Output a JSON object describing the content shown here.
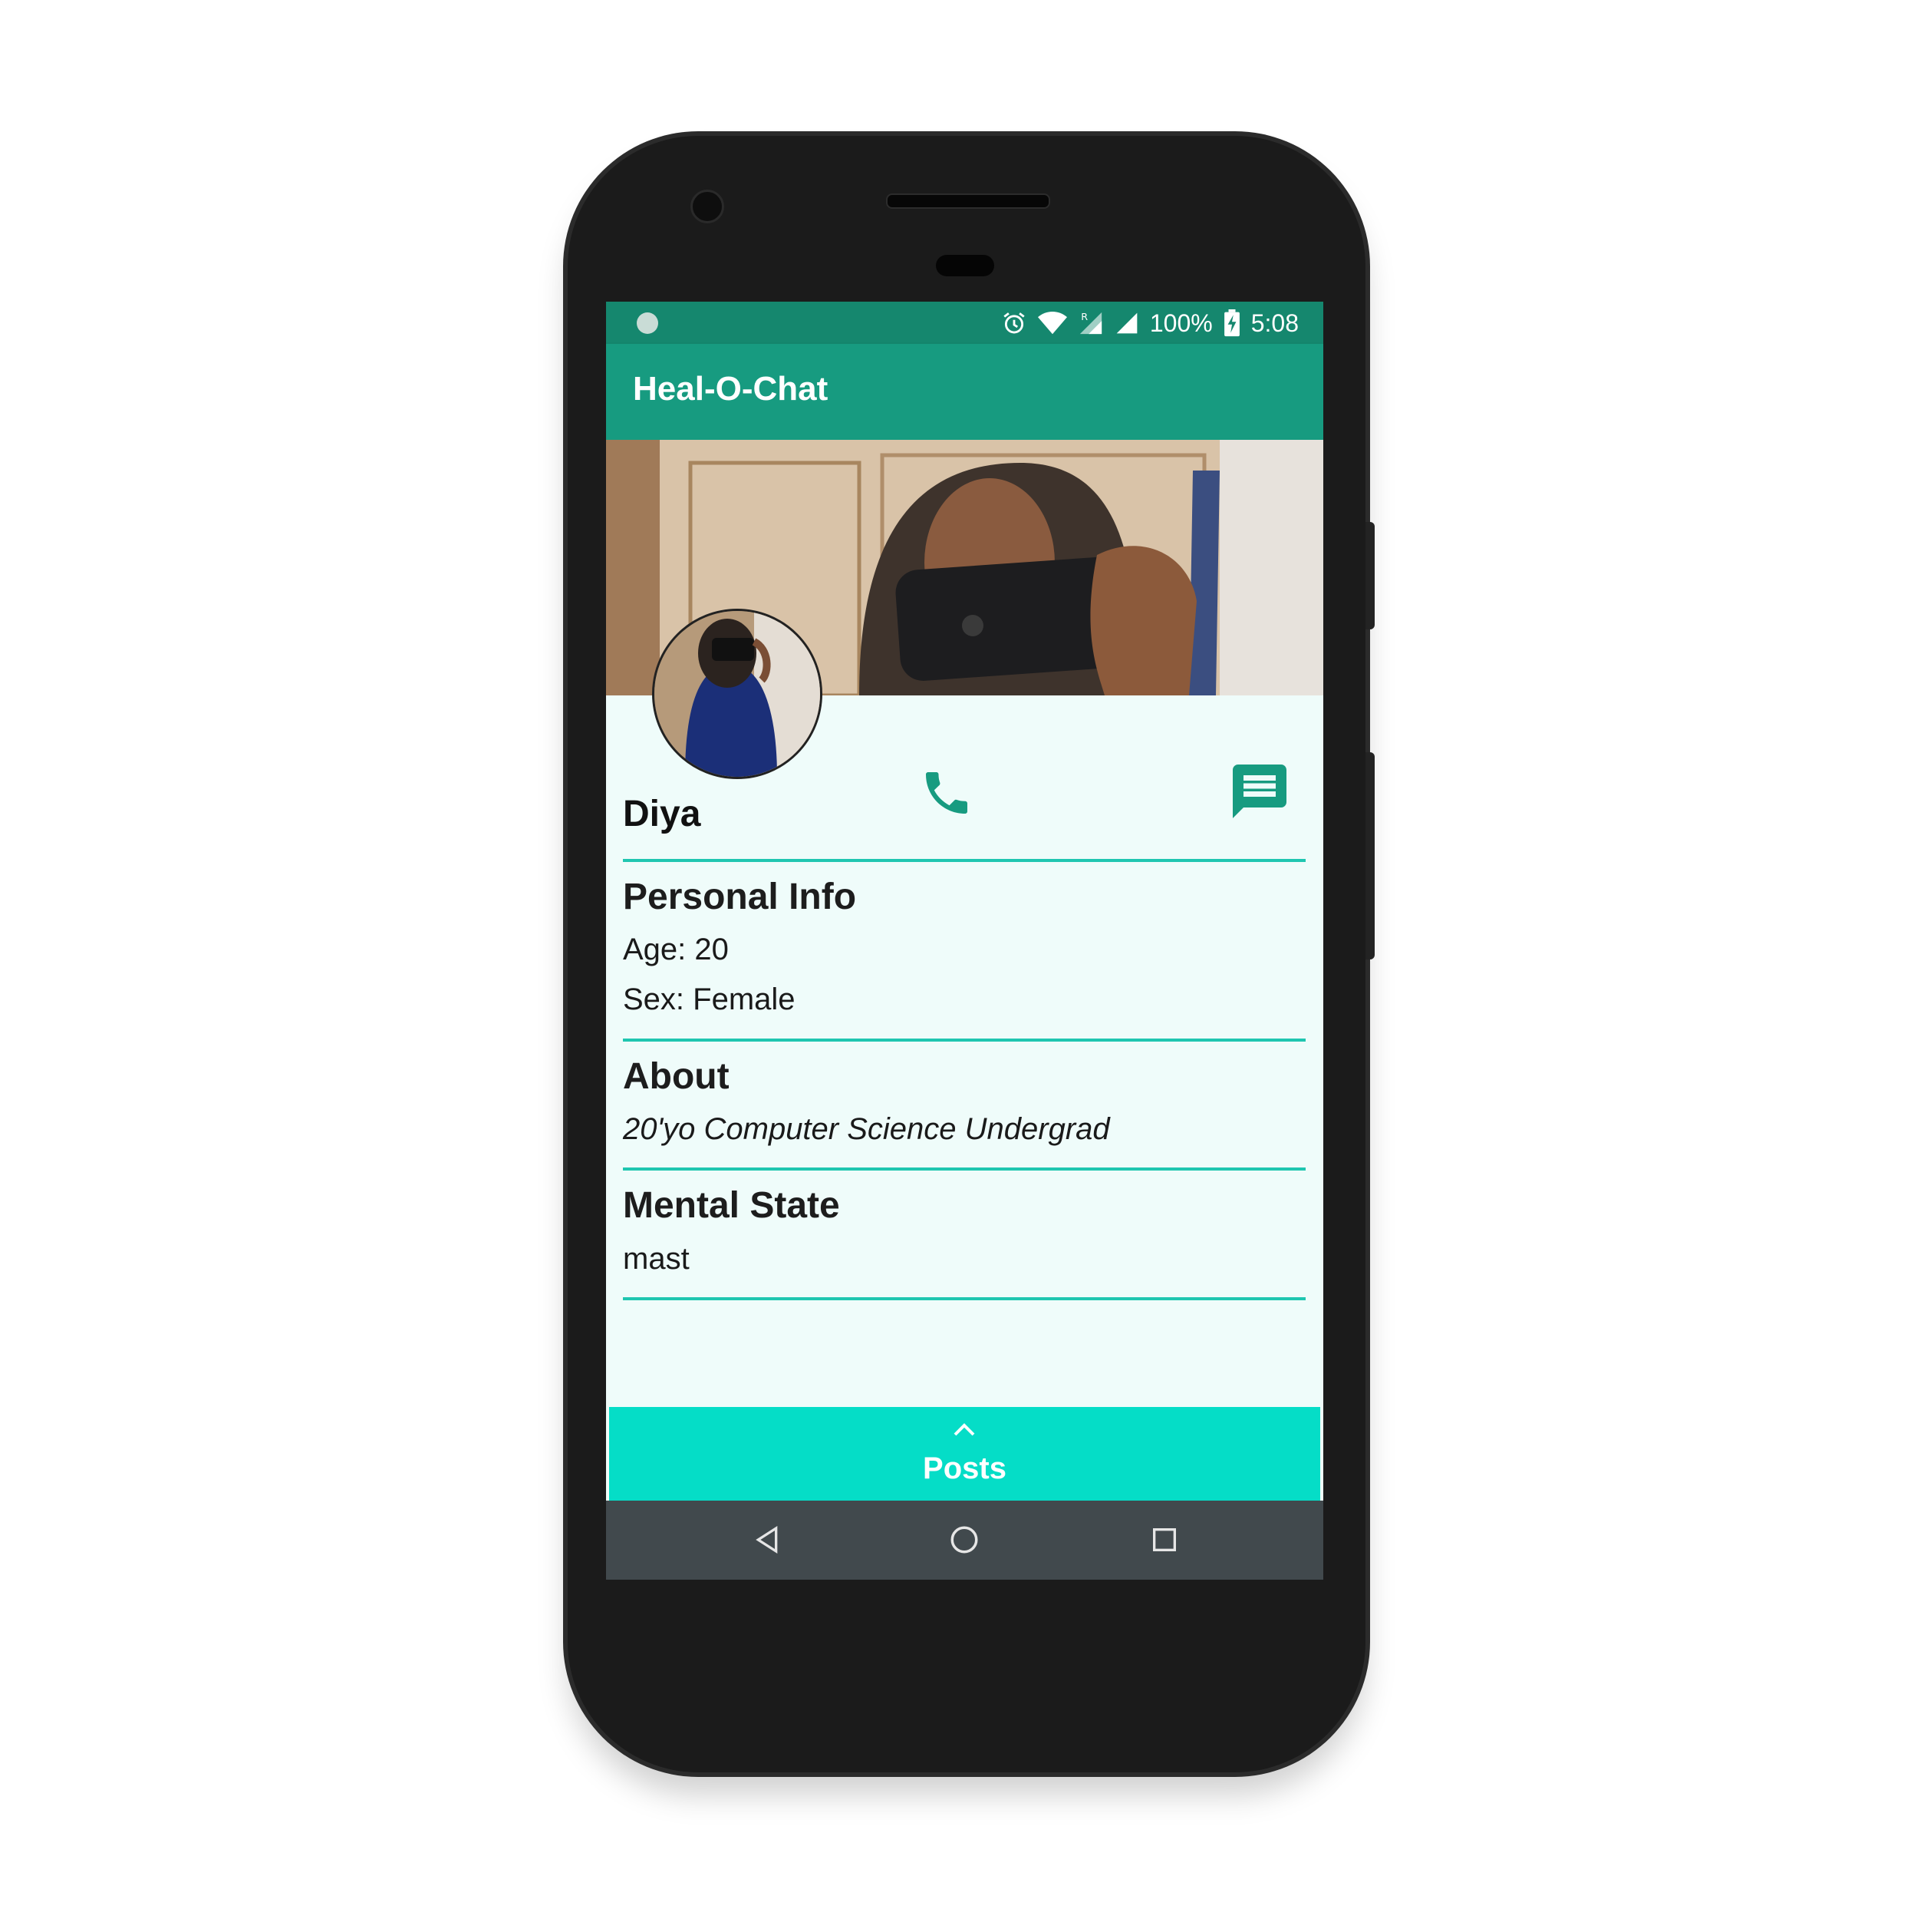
{
  "status_bar": {
    "battery": "100%",
    "time": "5:08",
    "icons": [
      "notification-dot-icon",
      "alarm-icon",
      "wifi-icon",
      "roaming-signal-icon",
      "signal-icon",
      "battery-charging-icon"
    ]
  },
  "app_bar": {
    "title": "Heal-O-Chat"
  },
  "profile": {
    "name": "Diya",
    "actions": [
      "phone-icon",
      "message-icon"
    ]
  },
  "sections": {
    "personal": {
      "title": "Personal Info",
      "age": "Age: 20",
      "sex": "Sex: Female"
    },
    "about": {
      "title": "About",
      "text": "20'yo Computer Science Undergrad"
    },
    "mental": {
      "title": "Mental State",
      "text": "mast"
    }
  },
  "posts_bar": {
    "label": "Posts",
    "icon": "chevron-up-icon"
  },
  "nav_bar": {
    "icons": [
      "back-icon",
      "home-icon",
      "recents-icon"
    ]
  },
  "colors": {
    "status_bar": "#15876e",
    "app_bar": "#179b80",
    "accent": "#1fc6b0",
    "posts_bar": "#05ddc7",
    "background": "#effcfa",
    "nav_bar": "#41494d"
  }
}
